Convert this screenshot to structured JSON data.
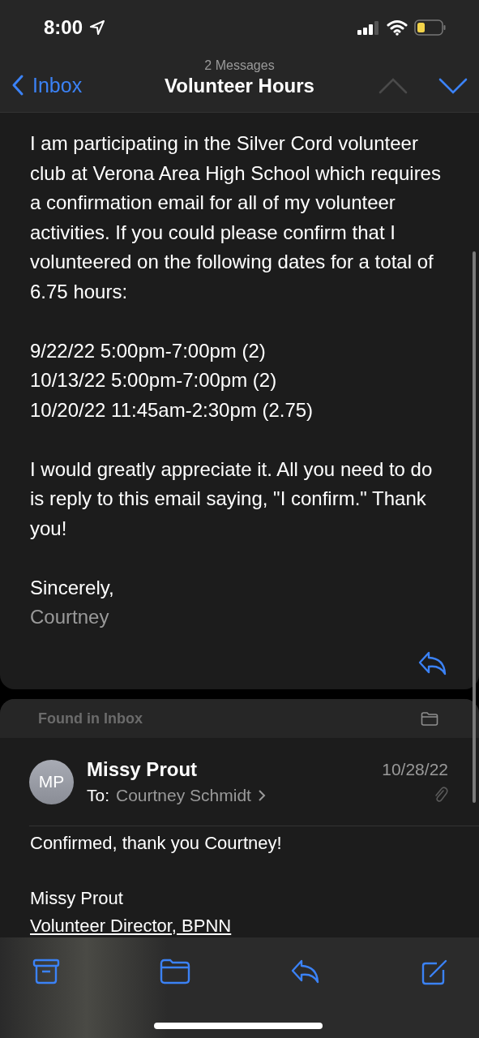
{
  "status_bar": {
    "time": "8:00"
  },
  "nav": {
    "back_label": "Inbox",
    "subtitle": "2 Messages",
    "title": "Volunteer Hours",
    "previous_enabled": false,
    "next_enabled": true
  },
  "message": {
    "paragraphs": [
      "I am participating in the Silver Cord volunteer club at Verona Area High School which requires a confirmation email for all of my volunteer activities. If you could please confirm that I volunteered on the following dates for a total of 6.75 hours:"
    ],
    "dates": [
      "9/22/22 5:00pm-7:00pm (2)",
      "10/13/22 5:00pm-7:00pm (2)",
      "10/20/22 11:45am-2:30pm (2.75)"
    ],
    "request": "I would greatly appreciate it. All you need to do is reply to this email saying, \"I confirm.\" Thank you!",
    "closing": "Sincerely,",
    "signature": "Courtney"
  },
  "found_in": "Found in Inbox",
  "reply_message": {
    "initials": "MP",
    "sender": "Missy Prout",
    "to_label": "To:",
    "recipient": "Courtney Schmidt",
    "date": "10/28/22",
    "has_attachment": true,
    "body": "Confirmed, thank you Courtney!",
    "signature_name": "Missy Prout",
    "signature_title": "Volunteer Director, BPNN"
  }
}
